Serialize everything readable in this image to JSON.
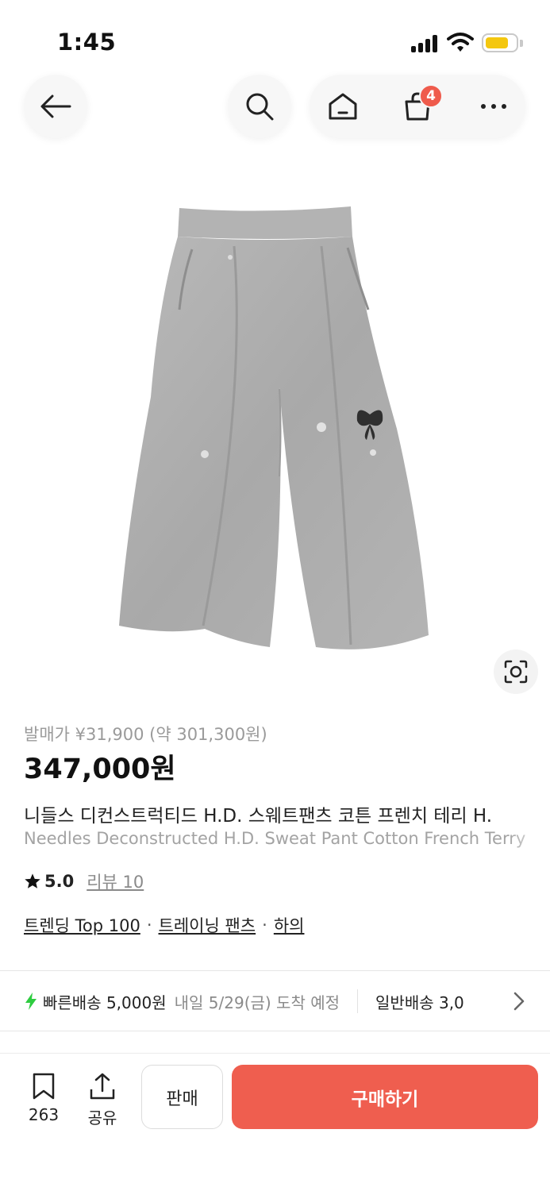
{
  "status_bar": {
    "time": "1:45"
  },
  "header": {
    "cart_count": "4",
    "icons": [
      "back-arrow-icon",
      "search-icon",
      "home-icon",
      "shopping-bag-icon",
      "more-icon"
    ]
  },
  "product": {
    "release_price": "발매가 ¥31,900 (약 301,300원)",
    "price": "347,000원",
    "title_ko": "니들스 디컨스트럭티드 H.D. 스웨트팬츠 코튼 프렌치 테리 H.",
    "title_en": "Needles Deconstructed H.D. Sweat Pant Cotton French Terry",
    "rating": "5.0",
    "reviews": "리뷰 10",
    "tags": [
      "트렌딩 Top 100",
      "트레이닝 팬츠",
      "하의"
    ]
  },
  "shipping": {
    "fast_label": "빠른배송 5,000원",
    "fast_date": "내일 5/29(금) 도착 예정",
    "normal_label": "일반배송 3,0",
    "accent_color": "#2ecc40"
  },
  "bottom_bar": {
    "bookmark_count": "263",
    "share_label": "공유",
    "sell_label": "판매",
    "buy_label": "구매하기",
    "buy_color": "#ef5e4f"
  }
}
